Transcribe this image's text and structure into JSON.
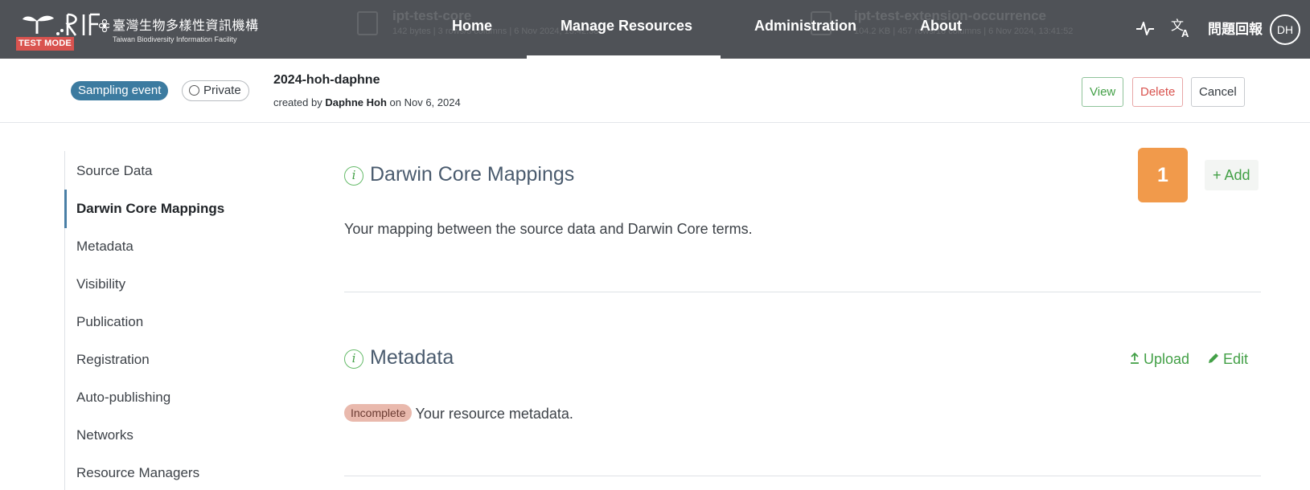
{
  "navbar": {
    "background_ghost": {
      "left_title": "ipt-test-core",
      "left_sub": "142 bytes | 3 rows/3 columns | 6 Nov 2024, 13:42:38",
      "right_title": "ipt-test-extension-occurrence",
      "right_sub": "104.2 KB | 457 rows/18 columns | 6 Nov 2024, 13:41:52"
    },
    "logo": {
      "org_name_zh": "臺灣生物多樣性資訊機構",
      "org_name_en": "Taiwan Biodiversity Information Facility",
      "mode_label": "TEST MODE"
    },
    "links": [
      {
        "label": "Home",
        "active": false
      },
      {
        "label": "Manage Resources",
        "active": true
      },
      {
        "label": "Administration",
        "active": false
      },
      {
        "label": "About",
        "active": false
      }
    ],
    "icons": [
      "activity-icon",
      "translate-icon"
    ],
    "feedback_label": "問題回報",
    "user_initials": "DH"
  },
  "resource": {
    "type_badge": "Sampling event",
    "visibility_badge": "Private",
    "name": "2024-hoh-daphne",
    "created_prefix": "created by",
    "creator": "Daphne Hoh",
    "created_suffix": "on Nov 6, 2024",
    "actions": {
      "view": "View",
      "delete": "Delete",
      "cancel": "Cancel"
    }
  },
  "sidenav": {
    "items": [
      {
        "label": "Source Data",
        "active": false
      },
      {
        "label": "Darwin Core Mappings",
        "active": true
      },
      {
        "label": "Metadata",
        "active": false
      },
      {
        "label": "Visibility",
        "active": false
      },
      {
        "label": "Publication",
        "active": false
      },
      {
        "label": "Registration",
        "active": false
      },
      {
        "label": "Auto-publishing",
        "active": false
      },
      {
        "label": "Networks",
        "active": false
      },
      {
        "label": "Resource Managers",
        "active": false
      }
    ]
  },
  "sections": {
    "mappings": {
      "info_glyph": "i",
      "title": "Darwin Core Mappings",
      "description": "Your mapping between the source data and Darwin Core terms.",
      "step_number": "1",
      "add_label": "+ Add"
    },
    "metadata": {
      "info_glyph": "i",
      "title": "Metadata",
      "status_badge": "Incomplete",
      "description": "Your resource metadata.",
      "upload_label": "Upload",
      "edit_label": "Edit"
    }
  },
  "colors": {
    "navbar_bg": "#4f5257",
    "accent_green": "#43a047",
    "type_badge_bg": "#3c7ba0",
    "step_badge_bg": "#f19a4b",
    "incomplete_bg": "#e9b9ad",
    "test_mode_bg": "#d9534f"
  }
}
